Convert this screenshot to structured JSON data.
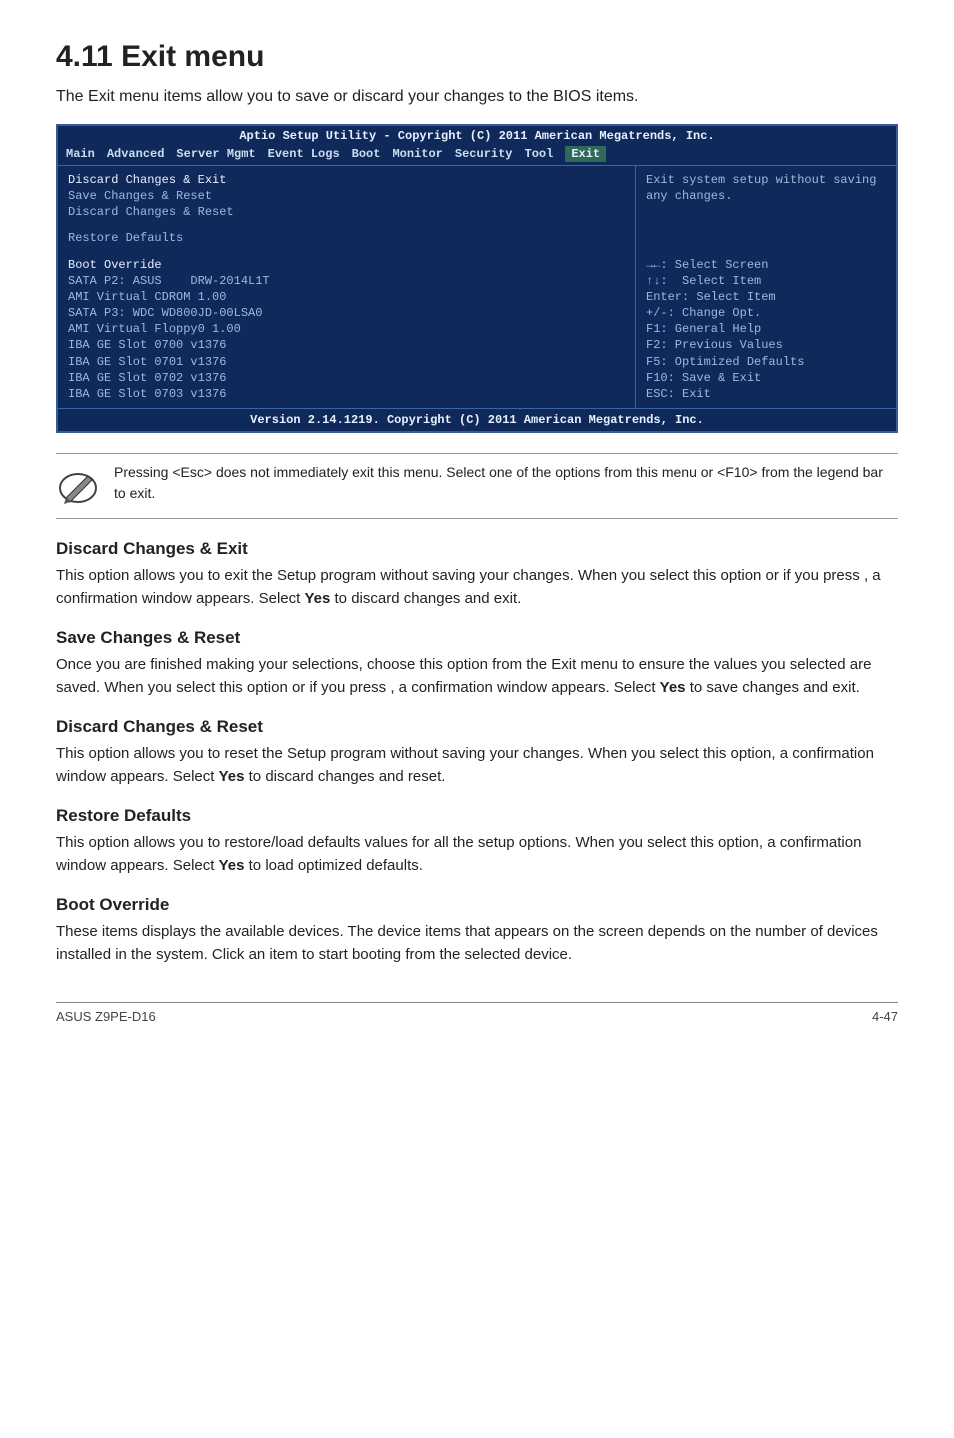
{
  "title": "4.11   Exit menu",
  "intro": "The Exit menu items allow you to save or discard your changes to the BIOS items.",
  "bios": {
    "header": "Aptio Setup Utility - Copyright (C) 2011 American Megatrends, Inc.",
    "menubar": [
      "Main",
      "Advanced",
      "Server Mgmt",
      "Event Logs",
      "Boot",
      "Monitor",
      "Security",
      "Tool",
      "Exit"
    ],
    "active_tab": "Exit",
    "left": [
      {
        "text": "Discard Changes & Exit",
        "hl": true
      },
      {
        "text": "Save Changes & Reset",
        "hl": false
      },
      {
        "text": "Discard Changes & Reset",
        "hl": false
      },
      {
        "spacer": true
      },
      {
        "text": "Restore Defaults",
        "hl": false
      },
      {
        "spacer": true
      },
      {
        "text": "Boot Override",
        "hl": true
      },
      {
        "text": "SATA P2: ASUS    DRW-2014L1T",
        "hl": false
      },
      {
        "text": "AMI Virtual CDROM 1.00",
        "hl": false
      },
      {
        "text": "SATA P3: WDC WD800JD-00LSA0",
        "hl": false
      },
      {
        "text": "AMI Virtual Floppy0 1.00",
        "hl": false
      },
      {
        "text": "IBA GE Slot 0700 v1376",
        "hl": false
      },
      {
        "text": "IBA GE Slot 0701 v1376",
        "hl": false
      },
      {
        "text": "IBA GE Slot 0702 v1376",
        "hl": false
      },
      {
        "text": "IBA GE Slot 0703 v1376",
        "hl": false
      }
    ],
    "right_help": "Exit system setup without saving any changes.",
    "right_nav": [
      "→←: Select Screen",
      "↑↓:  Select Item",
      "Enter: Select Item",
      "+/-: Change Opt.",
      "F1: General Help",
      "F2: Previous Values",
      "F5: Optimized Defaults",
      "F10: Save & Exit",
      "ESC: Exit"
    ],
    "footer": "Version 2.14.1219. Copyright (C) 2011 American Megatrends, Inc."
  },
  "note": "Pressing <Esc> does not immediately exit this menu. Select one of the options from this menu or <F10> from the legend bar to exit.",
  "sections": [
    {
      "head": "Discard Changes & Exit",
      "body": "This option allows you to exit the Setup program without saving your changes. When you select this option or if you press <Esc>, a confirmation window appears. Select Yes to discard changes and exit."
    },
    {
      "head": "Save Changes & Reset",
      "body": "Once you are finished making your selections, choose this option from the Exit menu to ensure the values you selected are saved. When you select this option or if you press <F10>, a confirmation window appears. Select Yes to save changes and exit."
    },
    {
      "head": "Discard Changes & Reset",
      "body": "This option allows you to reset the Setup program without saving your changes. When you select this option, a confirmation window appears. Select Yes to discard changes and reset."
    },
    {
      "head": "Restore Defaults",
      "body": "This option allows you to restore/load defaults values for all the setup options. When you select this option, a confirmation window appears. Select Yes to load optimized defaults."
    },
    {
      "head": "Boot Override",
      "body": "These items displays the available devices. The device items that appears on the screen depends on the number of devices installed in the system. Click an item to start booting from the selected device."
    }
  ],
  "footer_left": "ASUS Z9PE-D16",
  "footer_right": "4-47"
}
